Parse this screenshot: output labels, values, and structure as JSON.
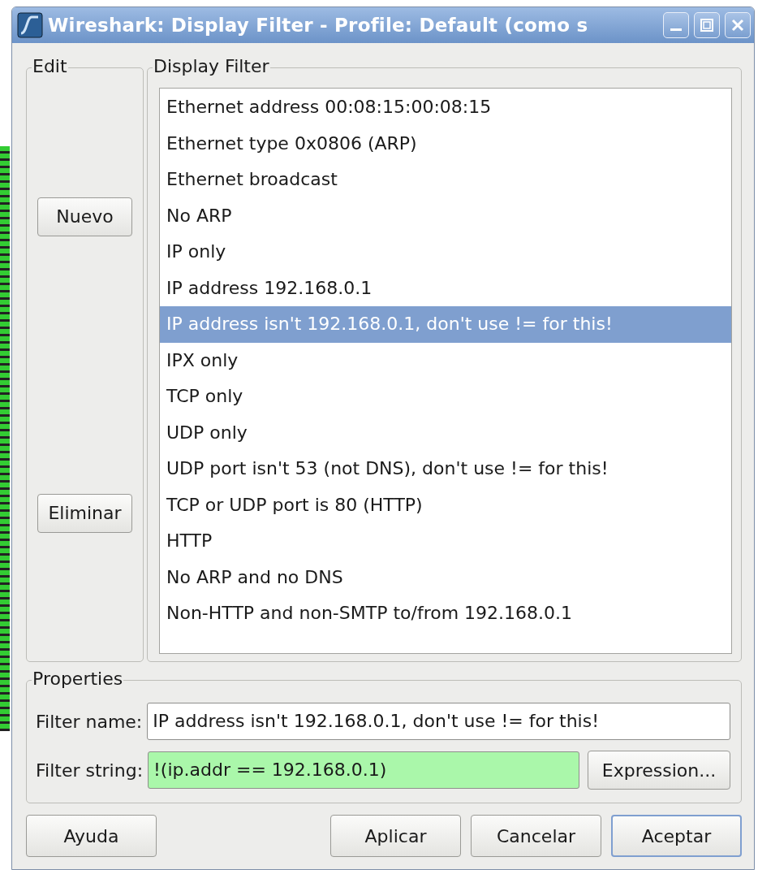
{
  "window": {
    "title": "Wireshark: Display Filter - Profile: Default (como s"
  },
  "edit": {
    "legend": "Edit",
    "buttons": [
      {
        "label": "Nuevo"
      },
      {
        "label": "Eliminar"
      }
    ]
  },
  "display_filter": {
    "legend": "Display Filter",
    "items": [
      {
        "label": "Ethernet address 00:08:15:00:08:15",
        "selected": false
      },
      {
        "label": "Ethernet type 0x0806 (ARP)",
        "selected": false
      },
      {
        "label": "Ethernet broadcast",
        "selected": false
      },
      {
        "label": "No ARP",
        "selected": false
      },
      {
        "label": "IP only",
        "selected": false
      },
      {
        "label": "IP address 192.168.0.1",
        "selected": false
      },
      {
        "label": "IP address isn't 192.168.0.1, don't use != for this!",
        "selected": true
      },
      {
        "label": "IPX only",
        "selected": false
      },
      {
        "label": "TCP only",
        "selected": false
      },
      {
        "label": "UDP only",
        "selected": false
      },
      {
        "label": "UDP port isn't 53 (not DNS), don't use != for this!",
        "selected": false
      },
      {
        "label": "TCP or UDP port is 80 (HTTP)",
        "selected": false
      },
      {
        "label": "HTTP",
        "selected": false
      },
      {
        "label": "No ARP and no DNS",
        "selected": false
      },
      {
        "label": "Non-HTTP and non-SMTP to/from 192.168.0.1",
        "selected": false
      }
    ]
  },
  "properties": {
    "legend": "Properties",
    "filter_name": {
      "label": "Filter name:",
      "value": "IP address isn't 192.168.0.1, don't use != for this!"
    },
    "filter_string": {
      "label": "Filter string:",
      "value": "!(ip.addr == 192.168.0.1)",
      "valid": true
    },
    "expression_button": {
      "label": "Expression..."
    }
  },
  "buttons": [
    {
      "label": "Ayuda",
      "default": false
    },
    {
      "label": "Aplicar",
      "default": false
    },
    {
      "label": "Cancelar",
      "default": false
    },
    {
      "label": "Aceptar",
      "default": true
    }
  ]
}
